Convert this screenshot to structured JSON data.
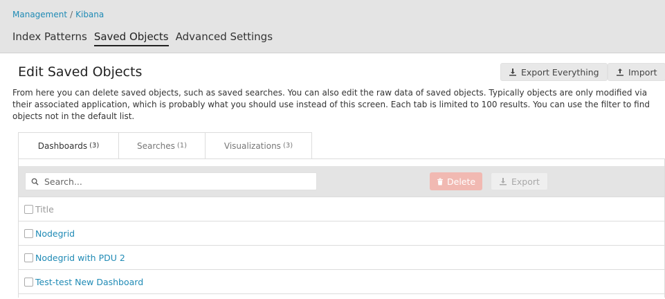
{
  "breadcrumb": {
    "parent": "Management",
    "separator": "/",
    "current": "Kibana"
  },
  "management_tabs": [
    {
      "label": "Index Patterns"
    },
    {
      "label": "Saved Objects"
    },
    {
      "label": "Advanced Settings"
    }
  ],
  "page": {
    "title": "Edit Saved Objects",
    "description": "From here you can delete saved objects, such as saved searches. You can also edit the raw data of saved objects. Typically objects are only modified via their associated application, which is probably what you should use instead of this screen. Each tab is limited to 100 results. You can use the filter to find objects not in the default list.",
    "export_everything_label": "Export Everything",
    "import_label": "Import"
  },
  "object_tabs": [
    {
      "label": "Dashboards",
      "count": "(3)"
    },
    {
      "label": "Searches",
      "count": "(1)"
    },
    {
      "label": "Visualizations",
      "count": "(3)"
    }
  ],
  "toolbar": {
    "search_placeholder": "Search...",
    "delete_label": "Delete",
    "export_label": "Export"
  },
  "table": {
    "header": "Title",
    "rows": [
      {
        "title": "Nodegrid"
      },
      {
        "title": "Nodegrid with PDU 2"
      },
      {
        "title": "Test-test New Dashboard"
      }
    ]
  },
  "colors": {
    "link": "#1f8ab5",
    "delete_disabled": "#f1b9b2",
    "header_bg": "#e4e4e4"
  },
  "icons": [
    "download-icon",
    "upload-icon",
    "search-icon",
    "trash-icon"
  ]
}
